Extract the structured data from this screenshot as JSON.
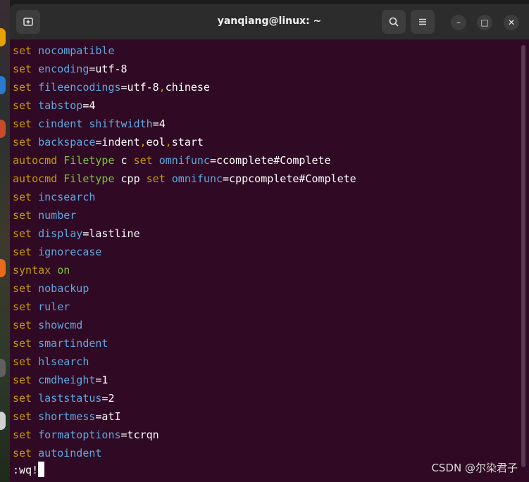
{
  "window": {
    "title": "yanqiang@linux: ~",
    "buttons": {
      "new_tab_icon": "new-tab-icon",
      "search_icon": "search-icon",
      "menu_icon": "hamburger-menu-icon",
      "minimize": "–",
      "maximize": "□",
      "close": "✕"
    }
  },
  "lines": [
    [
      [
        "set",
        "k-set"
      ],
      [
        " "
      ],
      [
        "nocompatible",
        "k-opt"
      ]
    ],
    [
      [
        "set",
        "k-set"
      ],
      [
        " "
      ],
      [
        "encoding",
        "k-opt"
      ],
      [
        "=utf-8",
        "k-val"
      ]
    ],
    [
      [
        "set",
        "k-set"
      ],
      [
        " "
      ],
      [
        "fileencodings",
        "k-opt"
      ],
      [
        "=utf-8",
        "k-val"
      ],
      [
        ",",
        "k-comma"
      ],
      [
        "chinese",
        "k-val"
      ]
    ],
    [
      [
        "set",
        "k-set"
      ],
      [
        " "
      ],
      [
        "tabstop",
        "k-opt"
      ],
      [
        "=4",
        "k-val"
      ]
    ],
    [
      [
        "set",
        "k-set"
      ],
      [
        " "
      ],
      [
        "cindent",
        "k-opt"
      ],
      [
        " "
      ],
      [
        "shiftwidth",
        "k-opt"
      ],
      [
        "=4",
        "k-val"
      ]
    ],
    [
      [
        "set",
        "k-set"
      ],
      [
        " "
      ],
      [
        "backspace",
        "k-opt"
      ],
      [
        "=indent",
        "k-val"
      ],
      [
        ",",
        "k-comma"
      ],
      [
        "eol",
        "k-val"
      ],
      [
        ",",
        "k-comma"
      ],
      [
        "start",
        "k-val"
      ]
    ],
    [
      [
        "autocmd",
        "k-kw"
      ],
      [
        " "
      ],
      [
        "Filetype",
        "k-type"
      ],
      [
        " c "
      ],
      [
        "set",
        "k-set"
      ],
      [
        " "
      ],
      [
        "omnifunc",
        "k-opt"
      ],
      [
        "=ccomplete#Complete",
        "k-val"
      ]
    ],
    [
      [
        "autocmd",
        "k-kw"
      ],
      [
        " "
      ],
      [
        "Filetype",
        "k-type"
      ],
      [
        " cpp "
      ],
      [
        "set",
        "k-set"
      ],
      [
        " "
      ],
      [
        "omnifunc",
        "k-opt"
      ],
      [
        "=cppcomplete#Complete",
        "k-val"
      ]
    ],
    [
      [
        "set",
        "k-set"
      ],
      [
        " "
      ],
      [
        "incsearch",
        "k-opt"
      ]
    ],
    [
      [
        "set",
        "k-set"
      ],
      [
        " "
      ],
      [
        "number",
        "k-opt"
      ]
    ],
    [
      [
        "set",
        "k-set"
      ],
      [
        " "
      ],
      [
        "display",
        "k-opt"
      ],
      [
        "=lastline",
        "k-val"
      ]
    ],
    [
      [
        "set",
        "k-set"
      ],
      [
        " "
      ],
      [
        "ignorecase",
        "k-opt"
      ]
    ],
    [
      [
        "syntax",
        "k-kw"
      ],
      [
        " "
      ],
      [
        "on",
        "k-type"
      ]
    ],
    [
      [
        "set",
        "k-set"
      ],
      [
        " "
      ],
      [
        "nobackup",
        "k-opt"
      ]
    ],
    [
      [
        "set",
        "k-set"
      ],
      [
        " "
      ],
      [
        "ruler",
        "k-opt"
      ]
    ],
    [
      [
        "set",
        "k-set"
      ],
      [
        " "
      ],
      [
        "showcmd",
        "k-opt"
      ]
    ],
    [
      [
        "set",
        "k-set"
      ],
      [
        " "
      ],
      [
        "smartindent",
        "k-opt"
      ]
    ],
    [
      [
        "set",
        "k-set"
      ],
      [
        " "
      ],
      [
        "hlsearch",
        "k-opt"
      ]
    ],
    [
      [
        "set",
        "k-set"
      ],
      [
        " "
      ],
      [
        "cmdheight",
        "k-opt"
      ],
      [
        "=1",
        "k-val"
      ]
    ],
    [
      [
        "set",
        "k-set"
      ],
      [
        " "
      ],
      [
        "laststatus",
        "k-opt"
      ],
      [
        "=2",
        "k-val"
      ]
    ],
    [
      [
        "set",
        "k-set"
      ],
      [
        " "
      ],
      [
        "shortmess",
        "k-opt"
      ],
      [
        "=atI",
        "k-val"
      ]
    ],
    [
      [
        "set",
        "k-set"
      ],
      [
        " "
      ],
      [
        "formatoptions",
        "k-opt"
      ],
      [
        "=tcrqn",
        "k-val"
      ]
    ],
    [
      [
        "set",
        "k-set"
      ],
      [
        " "
      ],
      [
        "autoindent",
        "k-opt"
      ]
    ]
  ],
  "command_line": ":wq!",
  "watermark": "CSDN @尔染君子",
  "colors": {
    "terminal_bg": "#300a24",
    "keyword": "#c49a00",
    "option": "#5fa8e0",
    "type": "#7cc242"
  }
}
